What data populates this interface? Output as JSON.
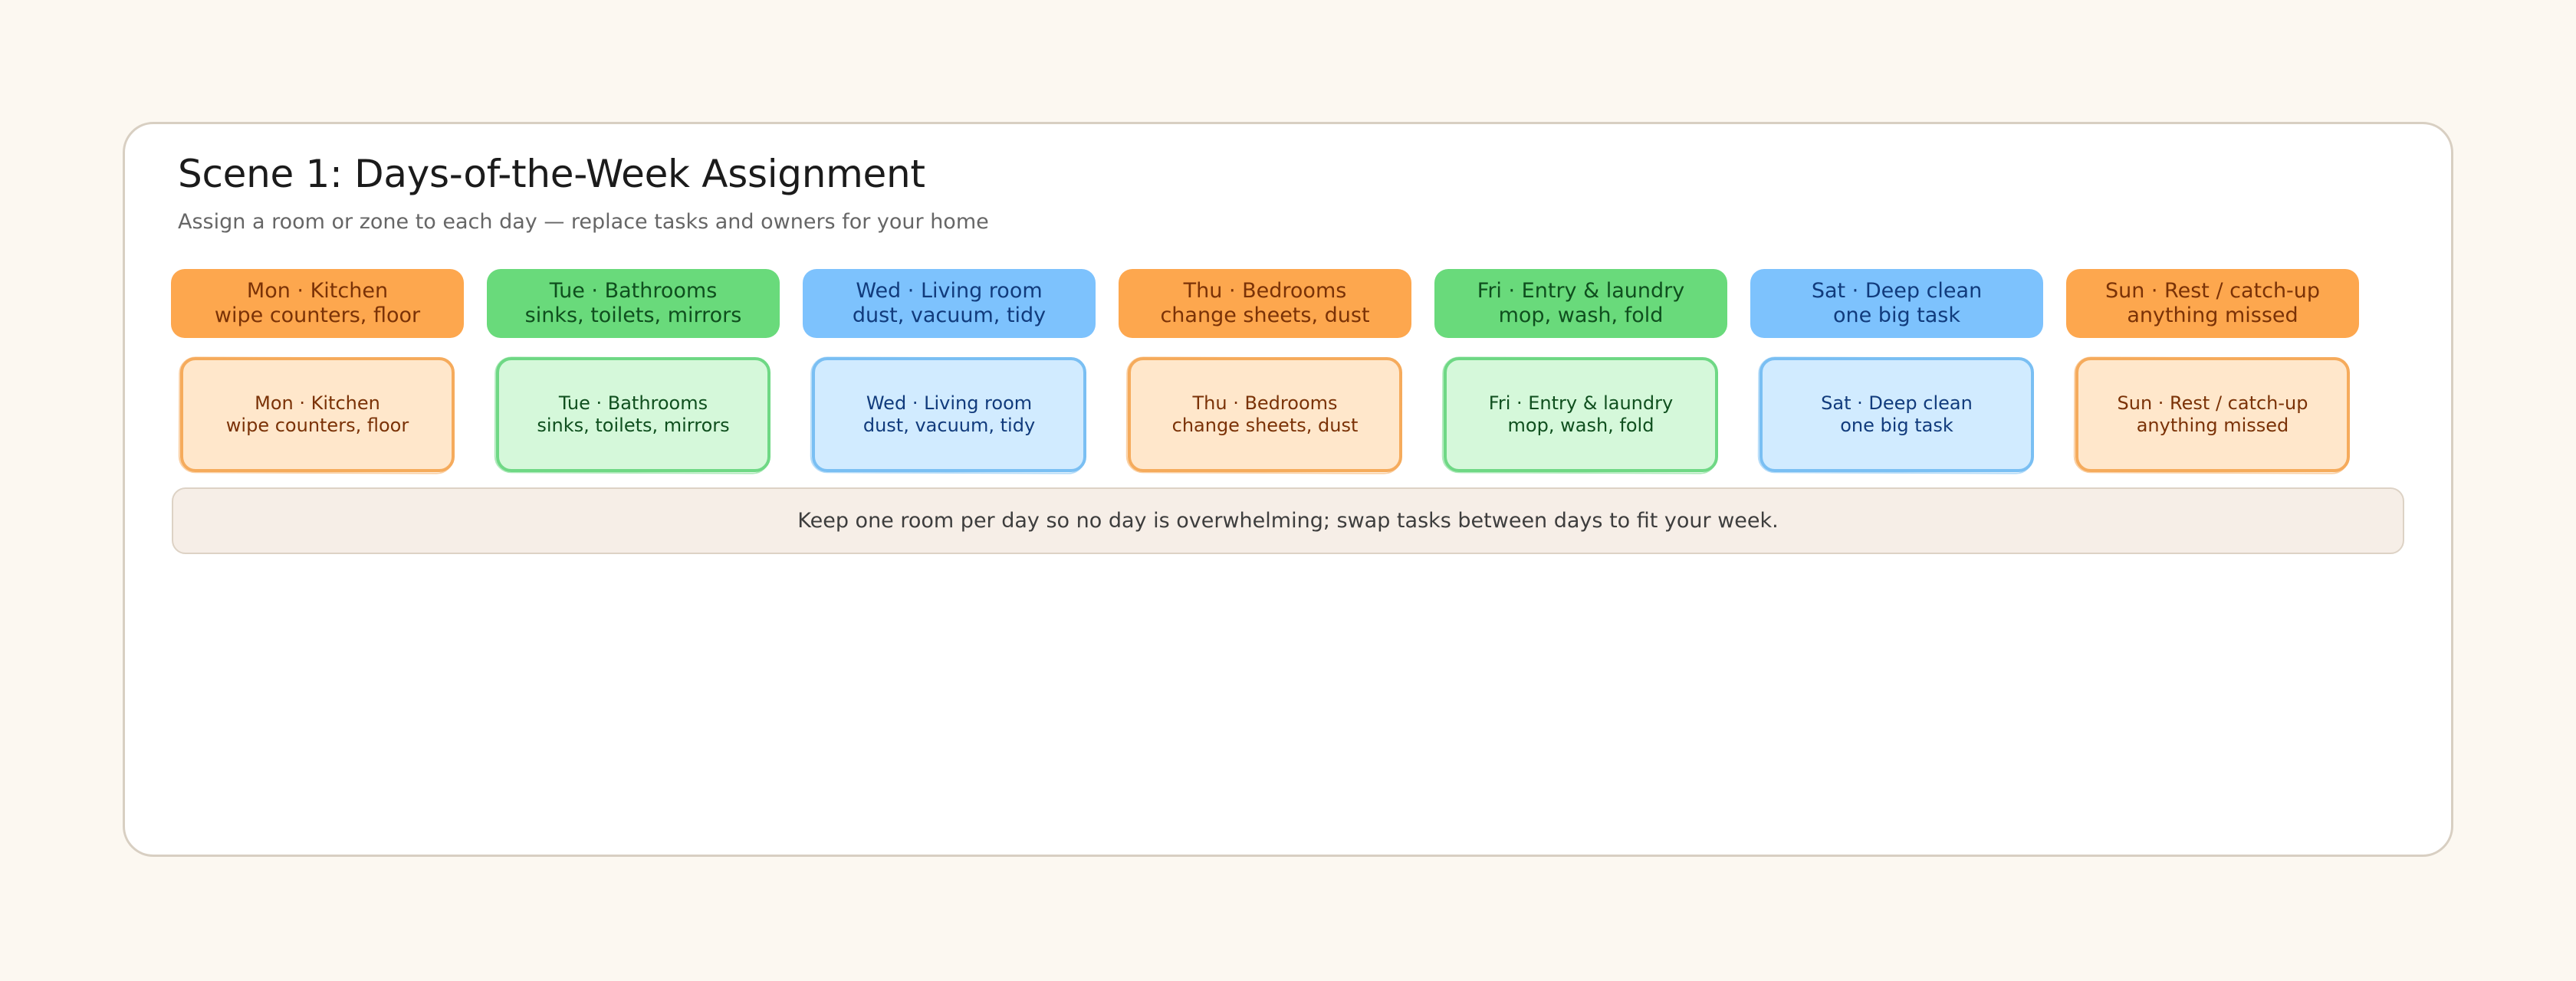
{
  "scene": {
    "title": "Scene 1: Days-of-the-Week Assignment",
    "subtitle": "Assign a room or zone to each day — replace tasks and owners for your home"
  },
  "colors": {
    "orange": "#fda74e",
    "green": "#69da7b",
    "blue": "#7dc2fd"
  },
  "days": [
    {
      "heading": "Mon · Kitchen",
      "tasks": "wipe counters, floor",
      "color": "orange"
    },
    {
      "heading": "Tue · Bathrooms",
      "tasks": "sinks, toilets, mirrors",
      "color": "green"
    },
    {
      "heading": "Wed · Living room",
      "tasks": "dust, vacuum, tidy",
      "color": "blue"
    },
    {
      "heading": "Thu · Bedrooms",
      "tasks": "change sheets, dust",
      "color": "orange"
    },
    {
      "heading": "Fri · Entry & laundry",
      "tasks": "mop, wash, fold",
      "color": "green"
    },
    {
      "heading": "Sat · Deep clean",
      "tasks": "one big task",
      "color": "blue"
    },
    {
      "heading": "Sun · Rest / catch-up",
      "tasks": "anything missed",
      "color": "orange"
    }
  ],
  "note": "Keep one room per day so no day is overwhelming; swap tasks between days to fit your week."
}
